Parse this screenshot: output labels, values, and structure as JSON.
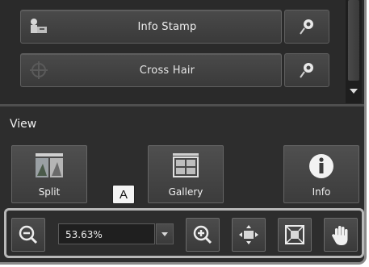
{
  "tools": {
    "info_stamp": {
      "label": "Info Stamp",
      "icon": "info-stamp-icon"
    },
    "cross_hair": {
      "label": "Cross Hair",
      "icon": "crosshair-icon"
    }
  },
  "view": {
    "title": "View",
    "buttons": [
      {
        "label": "Split",
        "icon": "split-view-icon"
      },
      {
        "label": "Gallery",
        "icon": "gallery-grid-icon"
      },
      {
        "label": "Info",
        "icon": "info-icon"
      }
    ]
  },
  "callout": {
    "label": "A"
  },
  "zoom": {
    "value": "53.63%",
    "buttons": [
      "zoom-out-icon",
      "zoom-in-icon",
      "fit-screen-icon",
      "full-size-icon",
      "hand-tool-icon"
    ]
  },
  "colors": {
    "panel": "#2a2a2a",
    "button": "#444444",
    "text": "#f0f0f0",
    "highlight_border": "#b8b8b8"
  }
}
